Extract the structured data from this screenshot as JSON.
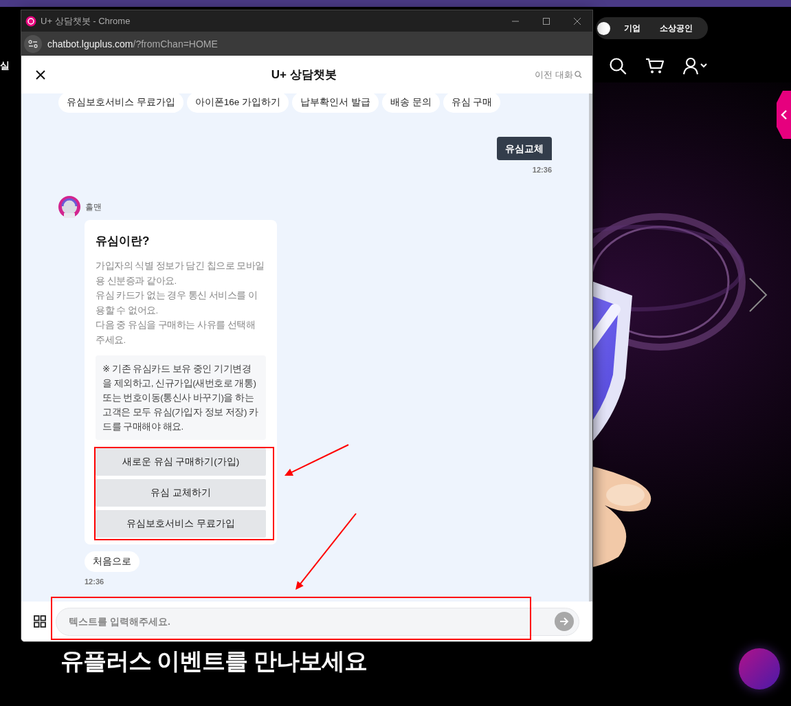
{
  "background_page": {
    "nav_left_text": "실",
    "segments": [
      {
        "label": "기업"
      },
      {
        "label": "소상공인"
      }
    ],
    "headline": "유플러스 이벤트를 만나보세요"
  },
  "browser_window": {
    "title": "U+ 상담챗봇 - Chrome",
    "url_host": "chatbot.lguplus.com",
    "url_path": "/?fromChan=HOME"
  },
  "chat_header": {
    "title": "U+ 상담챗봇",
    "history_link": "이전 대화"
  },
  "quick_replies": [
    "유심보호서비스 무료가입",
    "아이폰16e 가입하기",
    "납부확인서 발급",
    "배송 문의",
    "유심 구매"
  ],
  "messages": [
    {
      "kind": "user",
      "text": "유심교체",
      "time": "12:36"
    },
    {
      "kind": "bot",
      "sender": "홀맨",
      "title": "유심이란?",
      "paragraphs": [
        "가입자의 식별 정보가 담긴 칩으로 모바일용 신분증과 같아요.",
        "유심 카드가 없는 경우 통신 서비스를 이용할 수 없어요.",
        "다음 중 유심을 구매하는 사유를 선택해 주세요."
      ],
      "note": "※ 기존 유심카드 보유 중인 기기변경을 제외하고, 신규가입(새번호로 개통) 또는 번호이동(통신사 바꾸기)을 하는 고객은 모두 유심(가입자 정보 저장) 카드를 구매해야 해요.",
      "options": [
        "새로운 유심 구매하기(가입)",
        "유심 교체하기",
        "유심보호서비스 무료가입"
      ],
      "options_highlighted": true,
      "home_button": "처음으로",
      "time": "12:36"
    }
  ],
  "composer": {
    "placeholder": "텍스트를 입력해주세요.",
    "highlighted": true
  }
}
